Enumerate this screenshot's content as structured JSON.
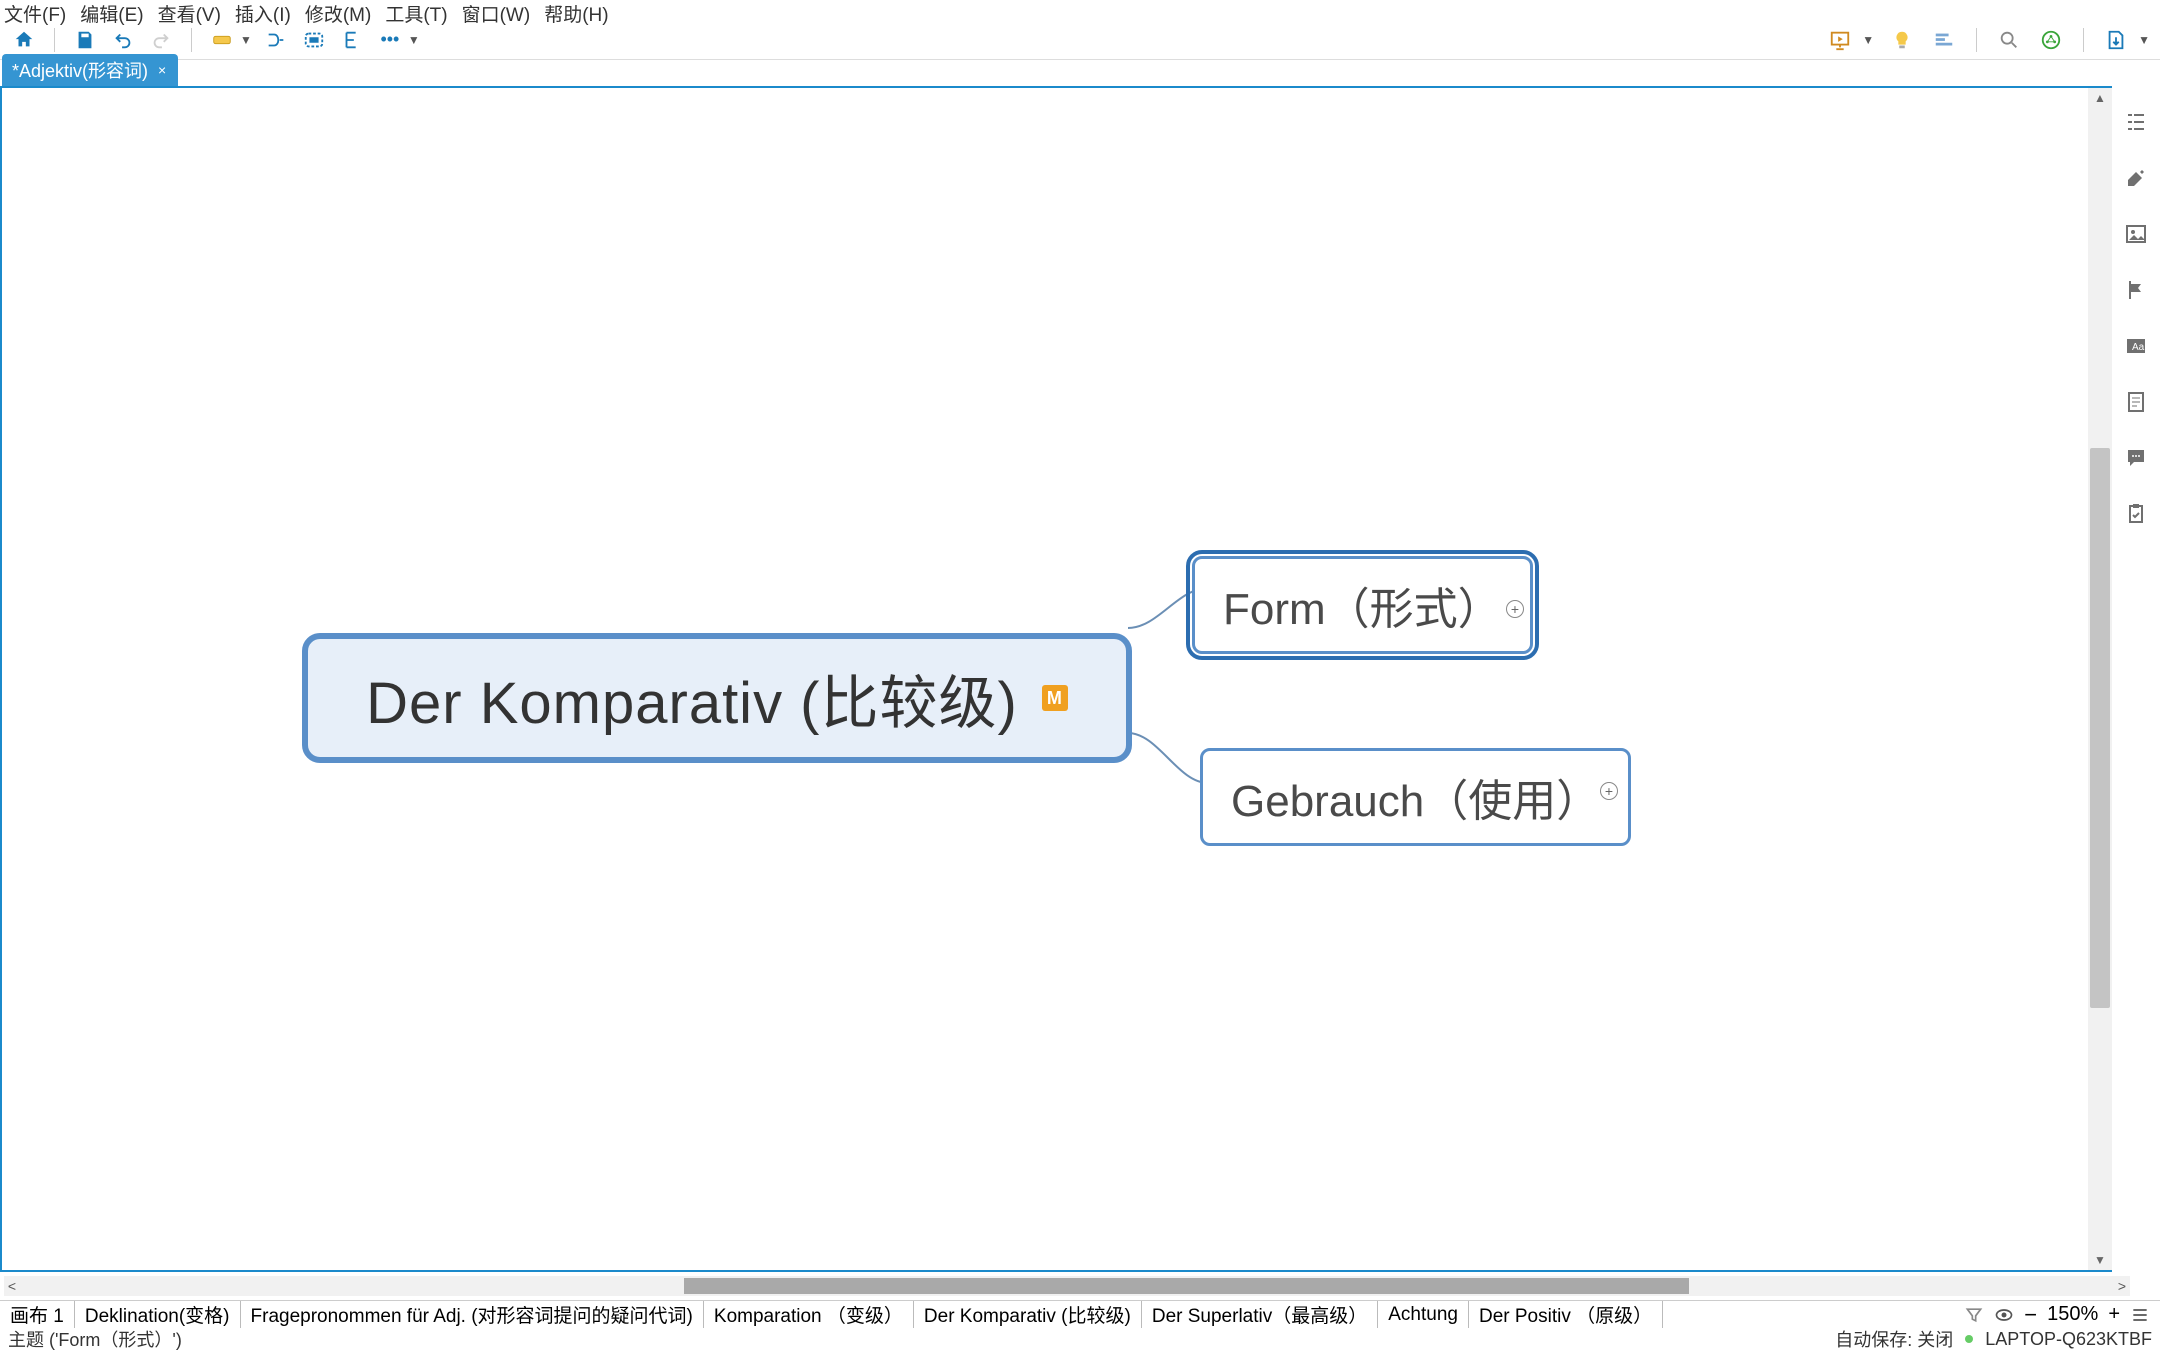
{
  "menu": {
    "file": "文件(F)",
    "edit": "编辑(E)",
    "view": "查看(V)",
    "insert": "插入(I)",
    "modify": "修改(M)",
    "tools": "工具(T)",
    "window": "窗口(W)",
    "help": "帮助(H)"
  },
  "doc_tab": {
    "label": "*Adjektiv(形容词)",
    "close": "×"
  },
  "mindmap": {
    "central": "Der Komparativ (比较级)",
    "marker": "M",
    "child_form": "Form（形式）",
    "child_gebrauch": "Gebrauch（使用）",
    "expand_symbol": "⊕"
  },
  "sheets": [
    "画布 1",
    "Deklination(变格)",
    "Fragepronommen für Adj. (对形容词提问的疑问代词)",
    "Komparation （变级）",
    "Der Komparativ (比较级)",
    "Der Superlativ（最高级）",
    "Achtung",
    "Der Positiv （原级）"
  ],
  "zoom": {
    "minus": "−",
    "plus": "+",
    "percent": "150%"
  },
  "status": {
    "topic": "主题 ('Form（形式）')",
    "autosave_label": "自动保存: 关闭",
    "device": "LAPTOP-Q623KTBF"
  },
  "colors": {
    "brand_blue": "#1b8acb",
    "node_border": "#5a8fc9",
    "node_fill": "#e7eff9"
  }
}
